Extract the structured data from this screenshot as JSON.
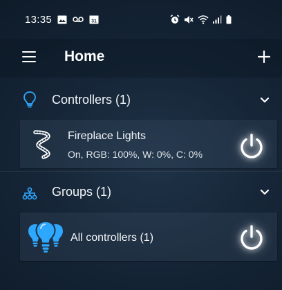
{
  "status_bar": {
    "time": "13:35",
    "left_icons": [
      "image-icon",
      "voicemail-icon",
      "calendar-icon"
    ],
    "calendar_day": "31",
    "right_icons": [
      "alarm-icon",
      "mute-icon",
      "wifi-icon",
      "signal-icon",
      "battery-icon"
    ]
  },
  "app_bar": {
    "title": "Home",
    "menu_icon": "hamburger-menu-icon",
    "add_icon": "plus-icon"
  },
  "sections": [
    {
      "title": "Controllers (1)",
      "icon": "lightbulb-outline-icon",
      "expanded": true,
      "items": [
        {
          "name": "Fireplace Lights",
          "status": "On, RGB: 100%, W: 0%, C: 0%",
          "icon": "led-strip-icon",
          "power_icon": "power-icon"
        }
      ]
    },
    {
      "title": "Groups (1)",
      "icon": "group-tree-icon",
      "expanded": true,
      "items": [
        {
          "name": "All controllers (1)",
          "icon": "lightbulbs-icon",
          "power_icon": "power-icon"
        }
      ]
    }
  ],
  "colors": {
    "accent": "#2ea8ff",
    "background_center": "#1f3347",
    "background_edge": "#0e1b29",
    "text": "#ffffff"
  }
}
